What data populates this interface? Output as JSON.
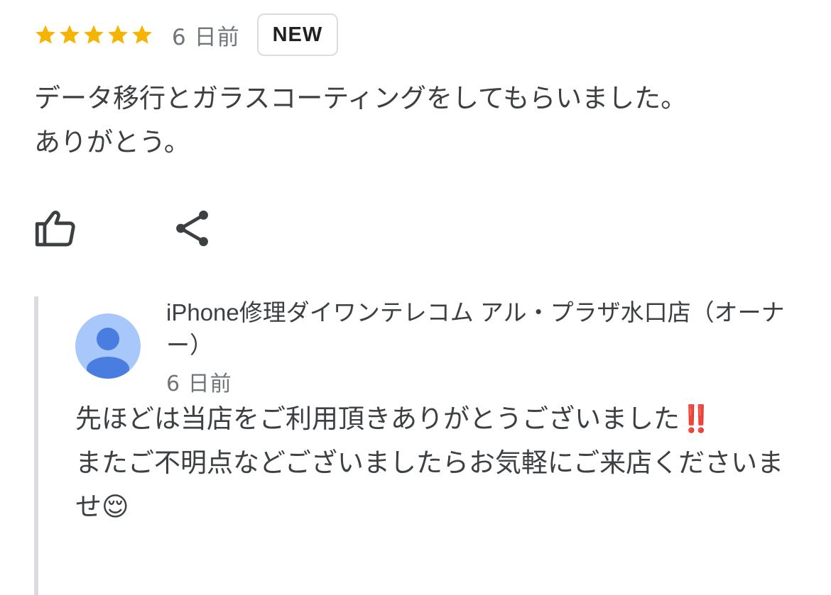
{
  "review": {
    "rating": 5,
    "max_rating": 5,
    "date": "6 日前",
    "badge": "NEW",
    "text": "データ移行とガラスコーティングをしてもらいました。\nありがとう。"
  },
  "actions": {
    "like_icon": "thumbs-up-icon",
    "share_icon": "share-icon"
  },
  "owner_reply": {
    "avatar_icon": "person-icon",
    "name": "iPhone修理ダイワンテレコム アル・プラザ水口店（オーナー）",
    "date": "6 日前",
    "text": "先ほどは当店をご利用頂きありがとうございました‼️\nまたご不明点などございましたらお気軽にご来店くださいませ😌"
  },
  "colors": {
    "star": "#F4B400",
    "secondary_text": "#70757a",
    "avatar_bg": "#a8c7fa",
    "avatar_fg": "#4a7de0",
    "border": "#dadce0"
  }
}
